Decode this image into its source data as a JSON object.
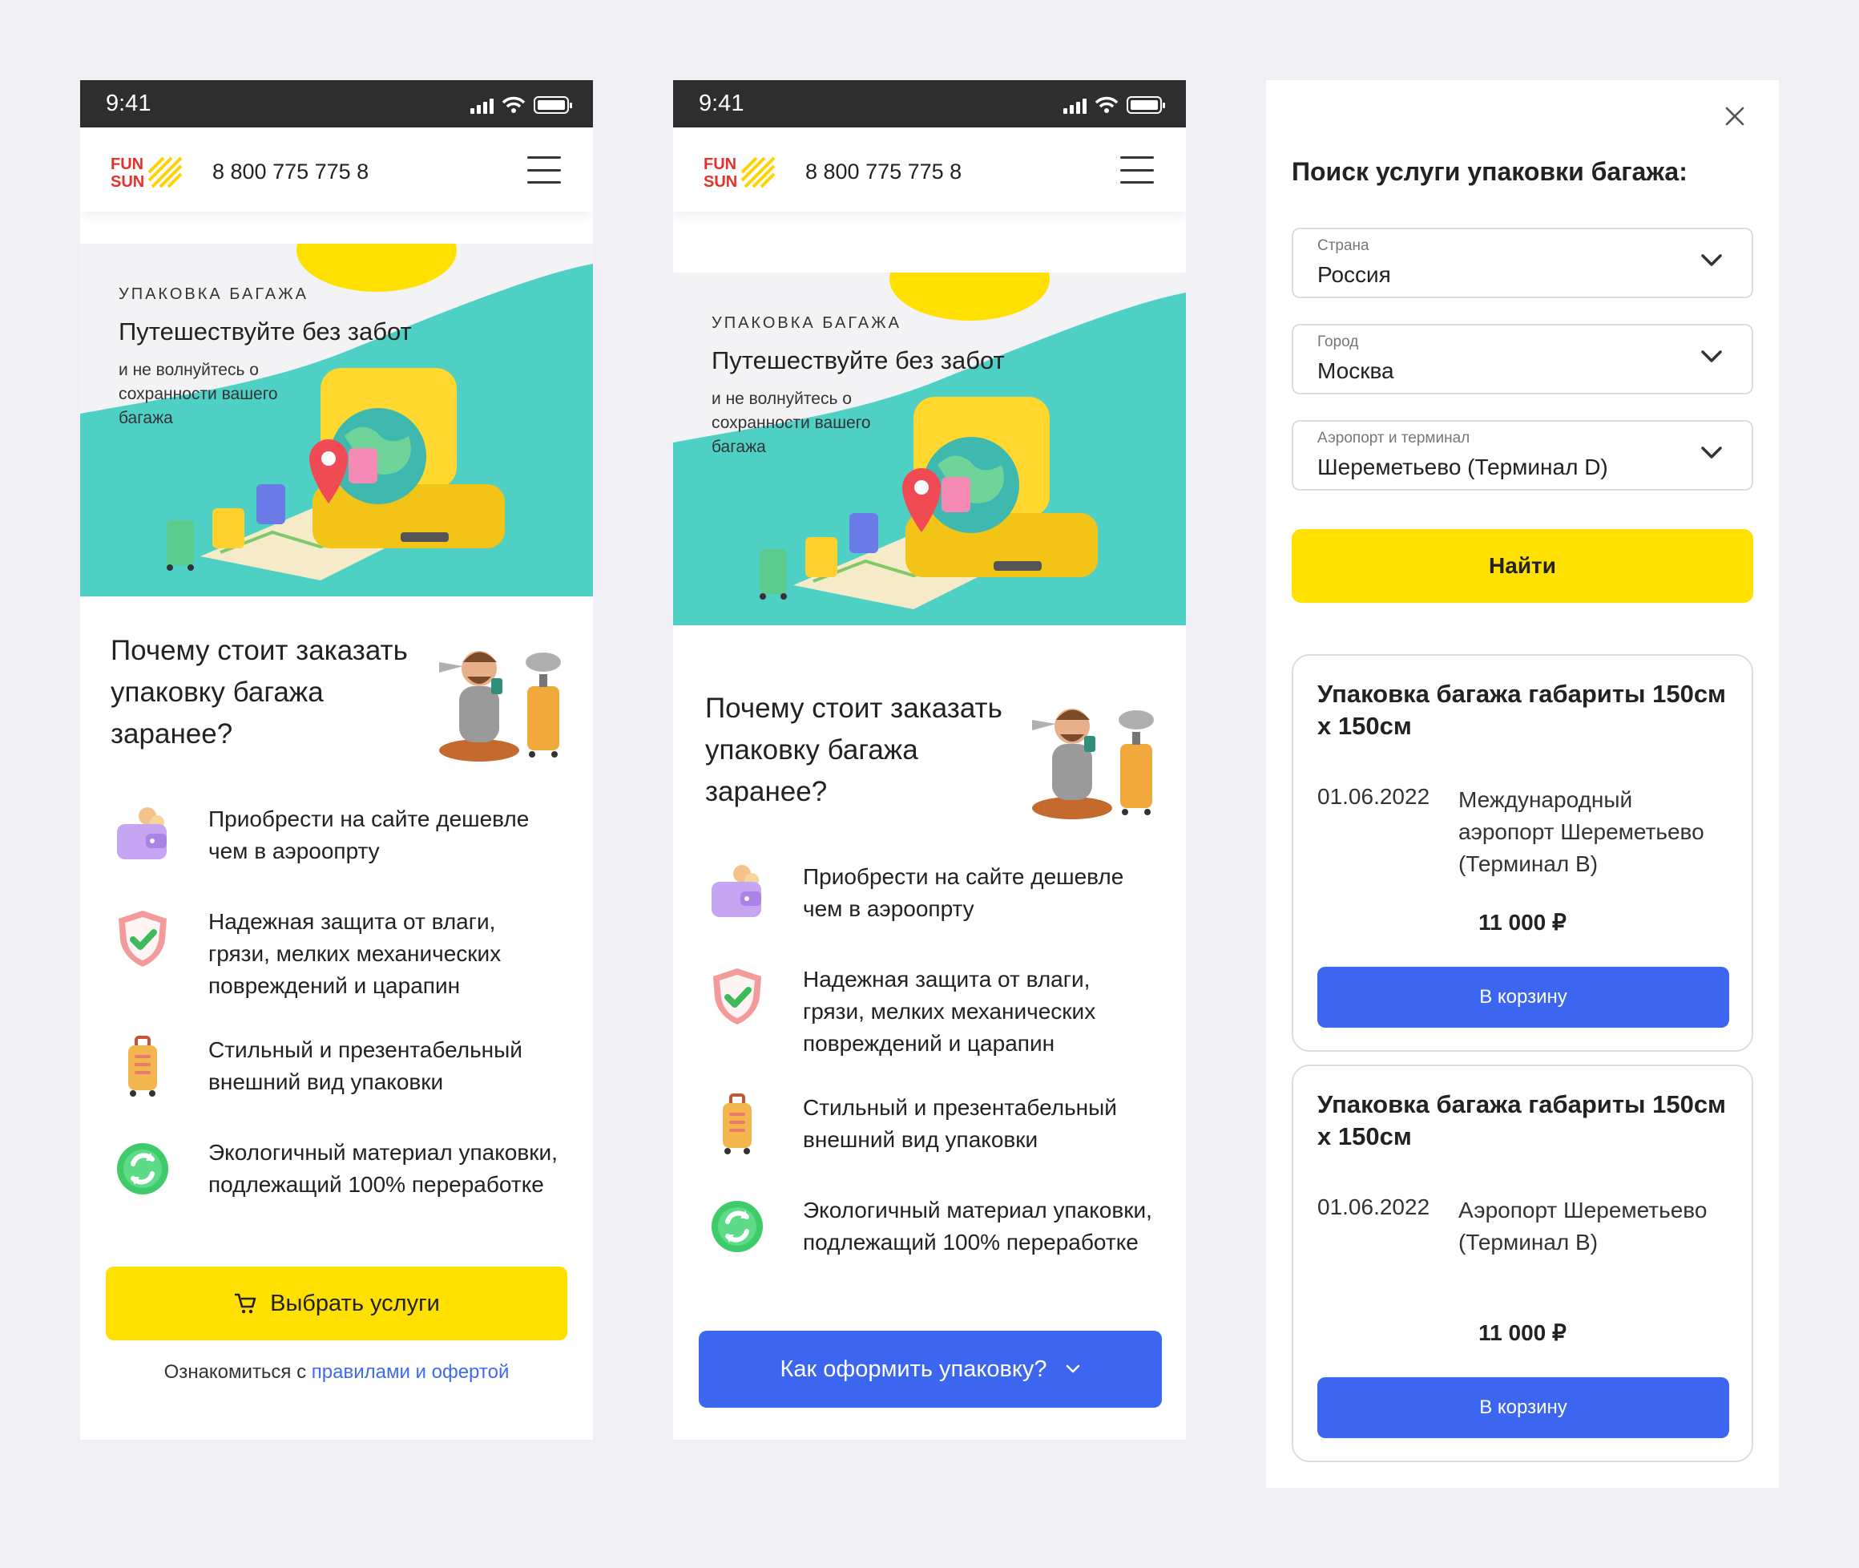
{
  "status": {
    "time": "9:41"
  },
  "brand": {
    "logo_text_top": "FUN",
    "logo_text_bottom": "SUN",
    "phone": "8 800 775 775 8"
  },
  "hero": {
    "kicker": "УПАКОВКА БАГАЖА",
    "title": "Путешествуйте без забот",
    "subtitle": "и не волнуйтесь о сохранности вашего багажа"
  },
  "why": {
    "title": "Почему стоит заказать упаковку багажа заранее?"
  },
  "benefits": [
    {
      "icon": "wallet-coins-icon",
      "text": "Приобрести на сайте дешевле чем в аэроопрту"
    },
    {
      "icon": "shield-check-icon",
      "text": "Надежная защита от влаги, грязи, мелких механических повреждений и царапин"
    },
    {
      "icon": "suitcase-icon",
      "text": "Стильный и презентабельный внешний вид упаковки"
    },
    {
      "icon": "recycle-icon",
      "text": "Экологичный материал упаковки, подлежащий 100% переработке"
    }
  ],
  "screen1": {
    "cta_label": "Выбрать услуги",
    "rules_prefix": "Ознакомиться с ",
    "rules_link": "правилами и офертой"
  },
  "screen2": {
    "howto_label": "Как оформить упаковку?"
  },
  "search": {
    "title": "Поиск услуги упаковки багажа:",
    "fields": [
      {
        "label": "Страна",
        "value": "Россия"
      },
      {
        "label": "Город",
        "value": "Москва"
      },
      {
        "label": "Аэропорт и терминал",
        "value": "Шереметьево (Терминал D)"
      }
    ],
    "find_label": "Найти"
  },
  "results": [
    {
      "title": "Упаковка багажа габариты 150см х 150см",
      "date": "01.06.2022",
      "place": "Международный аэропорт Шереметьево (Терминал В)",
      "price": "11 000 ₽",
      "button": "В корзину"
    },
    {
      "title": "Упаковка багажа габариты 150см х 150см",
      "date": "01.06.2022",
      "place": "Аэропорт Шереметьево (Терминал В)",
      "price": "11 000 ₽",
      "button": "В корзину"
    }
  ],
  "colors": {
    "accent_yellow": "#FFE000",
    "accent_blue": "#3C65F0",
    "teal": "#4FD0C4",
    "brand_red": "#E5312C"
  }
}
